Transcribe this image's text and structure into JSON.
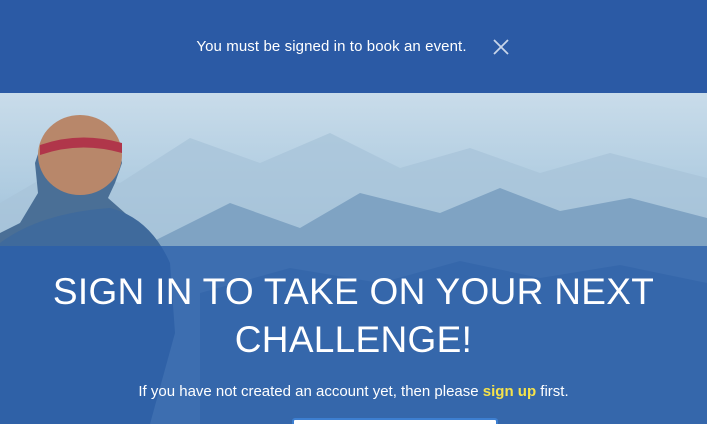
{
  "notice": {
    "message": "You must be signed in to book an event.",
    "close_icon": "close-icon"
  },
  "hero": {
    "headline_line1": "SIGN IN TO TAKE ON YOUR NEXT",
    "headline_line2": "CHALLENGE!",
    "subline_prefix": "If you have not created an account yet, then please",
    "signup_label": "sign up",
    "subline_suffix": "first."
  },
  "colors": {
    "notice_bg": "#2b5aa5",
    "overlay_bg": "#2a5faa",
    "link": "#f5e24a"
  }
}
